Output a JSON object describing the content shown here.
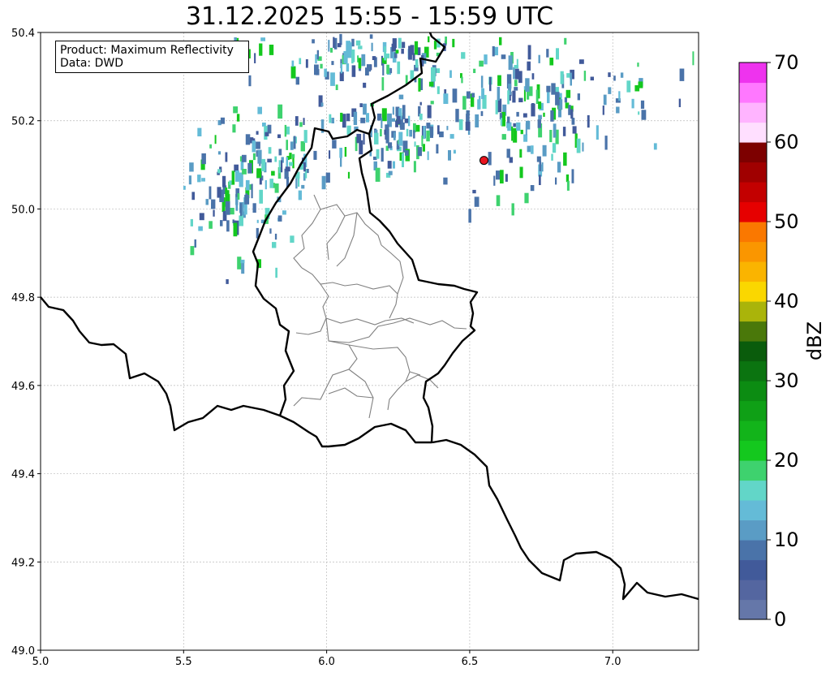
{
  "title": "31.12.2025 15:55 - 15:59 UTC",
  "info": {
    "product_label": "Product: Maximum Reflectivity",
    "data_label": "Data: DWD"
  },
  "map": {
    "lon_range": [
      5.0,
      7.3
    ],
    "lat_range": [
      49.0,
      50.4
    ],
    "x_ticks": [
      "5.0",
      "5.5",
      "6.0",
      "6.5",
      "7.0"
    ],
    "y_ticks": [
      "49.0",
      "49.2",
      "49.4",
      "49.6",
      "49.8",
      "50.0",
      "50.2",
      "50.4"
    ],
    "grid": true,
    "marker": {
      "lon": 6.55,
      "lat": 50.11,
      "color": "#e8141e"
    },
    "border_color": "#000000",
    "district_color": "#808080"
  },
  "colorbar": {
    "label": "dBZ",
    "min": 0,
    "max": 70,
    "ticks": [
      "0",
      "10",
      "20",
      "30",
      "40",
      "50",
      "60",
      "70"
    ],
    "colors": [
      "#6577a9",
      "#5466a0",
      "#415a9a",
      "#4a73a9",
      "#5a9cc5",
      "#64bbd7",
      "#62d6c8",
      "#3ed26e",
      "#14c81e",
      "#12b41a",
      "#0fa016",
      "#0c8c12",
      "#0b7410",
      "#0a5c0c",
      "#4a780a",
      "#aab40a",
      "#fad700",
      "#fab400",
      "#fa9600",
      "#fa7800",
      "#e60000",
      "#c30000",
      "#a00000",
      "#7d0000",
      "#ffdfff",
      "#ffb4ff",
      "#ff78ff",
      "#ee33ee"
    ]
  }
}
